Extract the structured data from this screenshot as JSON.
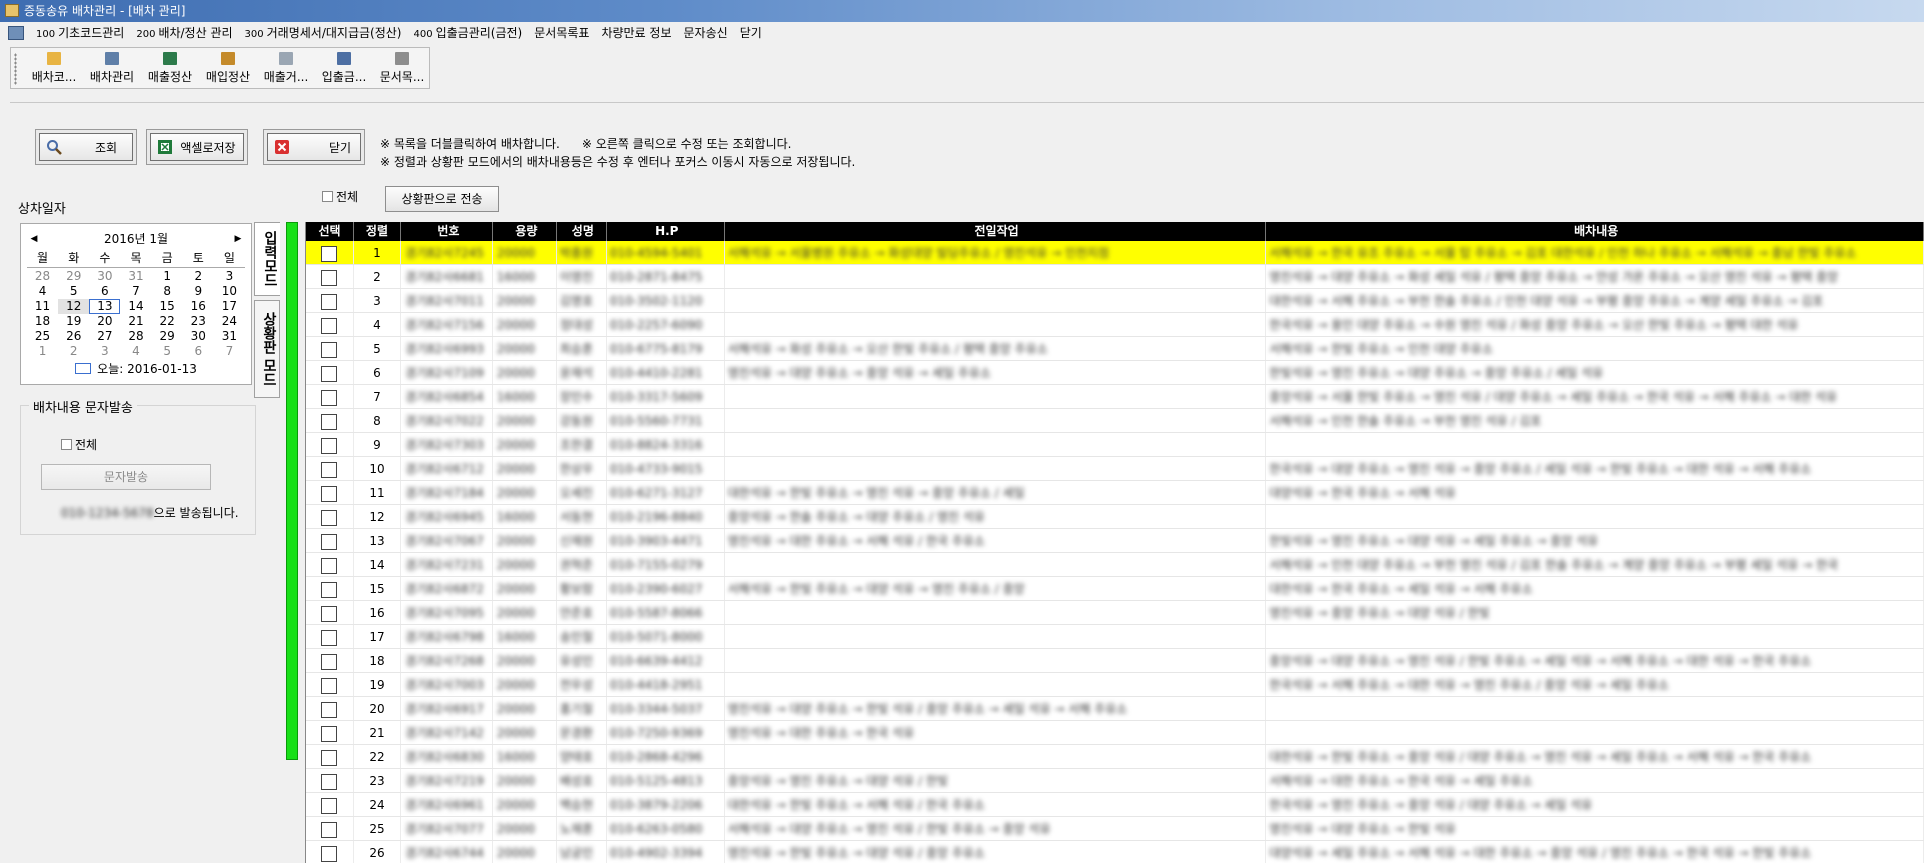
{
  "window": {
    "title": "증동송유 배차관리 - [배차 관리]"
  },
  "menu": [
    {
      "num": "100",
      "label": "기초코드관리"
    },
    {
      "num": "200",
      "label": "배차/정산 관리"
    },
    {
      "num": "300",
      "label": "거래명세서/대지급금(정산)"
    },
    {
      "num": "400",
      "label": "입출금관리(금전)"
    },
    {
      "num": "",
      "label": "문서목록표"
    },
    {
      "num": "",
      "label": "차량만료 정보"
    },
    {
      "num": "",
      "label": "문자송신"
    },
    {
      "num": "",
      "label": "닫기"
    }
  ],
  "toolbar": [
    {
      "label": "배차코...",
      "icon": "folder-icon",
      "color": "#e8b443"
    },
    {
      "label": "배차관리",
      "icon": "truck-icon",
      "color": "#5f7fa8"
    },
    {
      "label": "매출정산",
      "icon": "ledger-icon",
      "color": "#2c7a4a"
    },
    {
      "label": "매입정산",
      "icon": "pen-icon",
      "color": "#c48a2a"
    },
    {
      "label": "매출거...",
      "icon": "document-icon",
      "color": "#9aa6b3"
    },
    {
      "label": "입출금...",
      "icon": "money-icon",
      "color": "#4d6fa3"
    },
    {
      "label": "문서목...",
      "icon": "list-icon",
      "color": "#8d8d8d"
    }
  ],
  "actions": {
    "search": "조회",
    "excel": "액셀로저장",
    "close": "닫기"
  },
  "notes": {
    "line1a": "※ 목록을 더블클릭하여 배차합니다.",
    "line1b": "※ 오른쪽 클릭으로 수정 또는 조회합니다.",
    "line2": "※ 정렬과 상황판 모드에서의 배차내용등은 수정 후 엔터나 포커스 이동시 자동으로 저장됩니다."
  },
  "date_section": {
    "label": "상차일자"
  },
  "calendar": {
    "month_label": "2016년 1월",
    "weekdays": [
      "월",
      "화",
      "수",
      "목",
      "금",
      "토",
      "일"
    ],
    "weeks": [
      [
        "28",
        "29",
        "30",
        "31",
        "1",
        "2",
        "3"
      ],
      [
        "4",
        "5",
        "6",
        "7",
        "8",
        "9",
        "10"
      ],
      [
        "11",
        "12",
        "13",
        "14",
        "15",
        "16",
        "17"
      ],
      [
        "18",
        "19",
        "20",
        "21",
        "22",
        "23",
        "24"
      ],
      [
        "25",
        "26",
        "27",
        "28",
        "29",
        "30",
        "31"
      ],
      [
        "1",
        "2",
        "3",
        "4",
        "5",
        "6",
        "7"
      ]
    ],
    "today_label": "오늘: 2016-01-13"
  },
  "sms": {
    "group_label": "배차내용 문자발송",
    "all_label": "전체",
    "send_button": "문자발송",
    "send_suffix": "으로 발송됩니다.",
    "sender": "010-1234-5678"
  },
  "mode_tabs": {
    "input": "입력모드",
    "status": "상황판 모드"
  },
  "grid_top": {
    "all_label": "전체",
    "send_board": "상황판으로 전송"
  },
  "grid": {
    "headers": [
      "선택",
      "정렬",
      "번호",
      "용량",
      "성명",
      "H.P",
      "전일작업",
      "배차내용"
    ],
    "rows": [
      {
        "seq": "1",
        "num": "경기82사7245",
        "cap": "20000",
        "name": "박종원",
        "hp": "010-4594-5401",
        "prev": "서해석유 → 서울병원 주유소 → 화성대양 빌딩주유소 / 영진석유 → 인천지점",
        "disp": "서해석유 → 한국 유조 주유소 → 서울 탑 주유소 → 김포 대한석유 / 인천 하나 주유소 → 서해석유 → 충남 한빛 주유소"
      },
      {
        "seq": "2",
        "num": "경기82사6681",
        "cap": "16000",
        "name": "이영진",
        "hp": "010-2871-8475",
        "prev": "",
        "disp": "영진석유 → 대양 주유소 → 화성 세일 석유 / 평택 중앙 주유소 → 안성 가온 주유소 → 오산 영진 석유 → 평택 중앙"
      },
      {
        "seq": "3",
        "num": "경기82사7011",
        "cap": "20000",
        "name": "김명호",
        "hp": "010-3502-1120",
        "prev": "",
        "disp": "대한석유 → 서해 주유소 → 부천 한솔 주유소 / 인천 대양 석유 → 부평 중앙 주유소 → 계양 세일 주유소 → 김포"
      },
      {
        "seq": "4",
        "num": "경기82사7156",
        "cap": "20000",
        "name": "정대성",
        "hp": "010-2257-6090",
        "prev": "",
        "disp": "한국석유 → 용인 대양 주유소 → 수원 영진 석유 / 화성 중앙 주유소 → 오산 한빛 주유소 → 평택 대한 석유"
      },
      {
        "seq": "5",
        "num": "경기82사6993",
        "cap": "20000",
        "name": "최승훈",
        "hp": "010-6775-8179",
        "prev": "서해석유 → 화성 주유소 → 오산 한빛 주유소 / 평택 중앙 주유소",
        "disp": "서해석유 → 한빛 주유소 → 인천 대양 주유소"
      },
      {
        "seq": "6",
        "num": "경기82사7109",
        "cap": "20000",
        "name": "윤재석",
        "hp": "010-4410-2281",
        "prev": "영진석유 → 대양 주유소 → 중앙 석유 → 세일 주유소",
        "disp": "한빛석유 → 영진 주유소 → 대양 주유소 → 중앙 주유소 / 세일 석유"
      },
      {
        "seq": "7",
        "num": "경기82사6854",
        "cap": "16000",
        "name": "장민수",
        "hp": "010-3317-5609",
        "prev": "",
        "disp": "중앙석유 → 서울 한빛 주유소 → 영진 석유 / 대양 주유소 → 세일 주유소 → 한국 석유 → 서해 주유소 → 대한 석유"
      },
      {
        "seq": "8",
        "num": "경기82사7022",
        "cap": "20000",
        "name": "강동원",
        "hp": "010-5560-7731",
        "prev": "",
        "disp": "서해석유 → 인천 한솔 주유소 → 부천 영진 석유 / 김포"
      },
      {
        "seq": "9",
        "num": "경기82사7303",
        "cap": "20000",
        "name": "조한결",
        "hp": "010-8824-3316",
        "prev": "",
        "disp": ""
      },
      {
        "seq": "10",
        "num": "경기82사6712",
        "cap": "20000",
        "name": "한상우",
        "hp": "010-4733-9015",
        "prev": "",
        "disp": "한국석유 → 대양 주유소 → 영진 석유 → 중앙 주유소 / 세일 석유 → 한빛 주유소 → 대한 석유 → 서해 주유소"
      },
      {
        "seq": "11",
        "num": "경기82사7184",
        "cap": "20000",
        "name": "오세진",
        "hp": "010-6271-3127",
        "prev": "대한석유 → 한빛 주유소 → 영진 석유 → 중앙 주유소 / 세일",
        "disp": "대양석유 → 한국 주유소 → 서해 석유"
      },
      {
        "seq": "12",
        "num": "경기82사6945",
        "cap": "16000",
        "name": "서동현",
        "hp": "010-2196-8840",
        "prev": "중앙석유 → 한솔 주유소 → 대양 주유소 / 영진 석유",
        "disp": ""
      },
      {
        "seq": "13",
        "num": "경기82사7067",
        "cap": "20000",
        "name": "신재원",
        "hp": "010-3903-4471",
        "prev": "영진석유 → 대한 주유소 → 서해 석유 / 한국 주유소",
        "disp": "한빛석유 → 영진 주유소 → 대양 석유 → 세일 주유소 → 중앙 석유"
      },
      {
        "seq": "14",
        "num": "경기82사7231",
        "cap": "20000",
        "name": "권혁준",
        "hp": "010-7155-0279",
        "prev": "",
        "disp": "서해석유 → 인천 대양 주유소 → 부천 영진 석유 / 김포 한솔 주유소 → 계양 중앙 주유소 → 부평 세일 석유 → 한국"
      },
      {
        "seq": "15",
        "num": "경기82사6872",
        "cap": "20000",
        "name": "황보람",
        "hp": "010-2390-6027",
        "prev": "서해석유 → 한빛 주유소 → 대양 석유 → 영진 주유소 / 중앙",
        "disp": "대한석유 → 한국 주유소 → 세일 석유 → 서해 주유소"
      },
      {
        "seq": "16",
        "num": "경기82사7095",
        "cap": "20000",
        "name": "안준호",
        "hp": "010-5587-8066",
        "prev": "",
        "disp": "영진석유 → 중앙 주유소 → 대양 석유 / 한빛"
      },
      {
        "seq": "17",
        "num": "경기82사6798",
        "cap": "16000",
        "name": "송민철",
        "hp": "010-5071-8000",
        "prev": "",
        "disp": ""
      },
      {
        "seq": "18",
        "num": "경기82사7268",
        "cap": "20000",
        "name": "유성민",
        "hp": "010-6639-4412",
        "prev": "",
        "disp": "중앙석유 → 대양 주유소 → 영진 석유 / 한빛 주유소 → 세일 석유 → 서해 주유소 → 대한 석유 → 한국 주유소"
      },
      {
        "seq": "19",
        "num": "경기82사7003",
        "cap": "20000",
        "name": "전우성",
        "hp": "010-4418-2951",
        "prev": "",
        "disp": "한국석유 → 서해 주유소 → 대한 석유 → 영진 주유소 / 중앙 석유 → 세일 주유소"
      },
      {
        "seq": "20",
        "num": "경기82사6917",
        "cap": "20000",
        "name": "홍기철",
        "hp": "010-3344-5037",
        "prev": "영진석유 → 대양 주유소 → 한빛 석유 / 중앙 주유소 → 세일 석유 → 서해 주유소",
        "disp": ""
      },
      {
        "seq": "21",
        "num": "경기82사7142",
        "cap": "20000",
        "name": "문경환",
        "hp": "010-7250-9369",
        "prev": "영진석유 → 대한 주유소 → 한국 석유",
        "disp": ""
      },
      {
        "seq": "22",
        "num": "경기82사6830",
        "cap": "16000",
        "name": "양태호",
        "hp": "010-2868-4296",
        "prev": "",
        "disp": "대한석유 → 한빛 주유소 → 중앙 석유 / 대양 주유소 → 영진 석유 → 세일 주유소 → 서해 석유 → 한국 주유소"
      },
      {
        "seq": "23",
        "num": "경기82사7219",
        "cap": "20000",
        "name": "배성호",
        "hp": "010-5125-4813",
        "prev": "중앙석유 → 영진 주유소 → 대양 석유 / 한빛",
        "disp": "서해석유 → 대한 주유소 → 한국 석유 → 세일 주유소"
      },
      {
        "seq": "24",
        "num": "경기82사6961",
        "cap": "20000",
        "name": "백승현",
        "hp": "010-3879-2206",
        "prev": "대한석유 → 한빛 주유소 → 서해 석유 / 한국 주유소",
        "disp": "한국석유 → 영진 주유소 → 중앙 석유 / 대양 주유소 → 세일 석유"
      },
      {
        "seq": "25",
        "num": "경기82사7077",
        "cap": "20000",
        "name": "노재훈",
        "hp": "010-6263-0580",
        "prev": "서해석유 → 대양 주유소 → 영진 석유 / 한빛 주유소 → 중앙 석유",
        "disp": "영진석유 → 대양 주유소 → 한빛 석유"
      },
      {
        "seq": "26",
        "num": "경기82사6744",
        "cap": "20000",
        "name": "남궁민",
        "hp": "010-4902-3394",
        "prev": "영진석유 → 한빛 주유소 → 대양 석유 / 중앙 주유소",
        "disp": "대양석유 → 세일 주유소 → 서해 석유 → 대한 주유소 → 중앙 석유 / 영진 주유소 → 한국 석유 → 한빛 주유소"
      }
    ]
  }
}
